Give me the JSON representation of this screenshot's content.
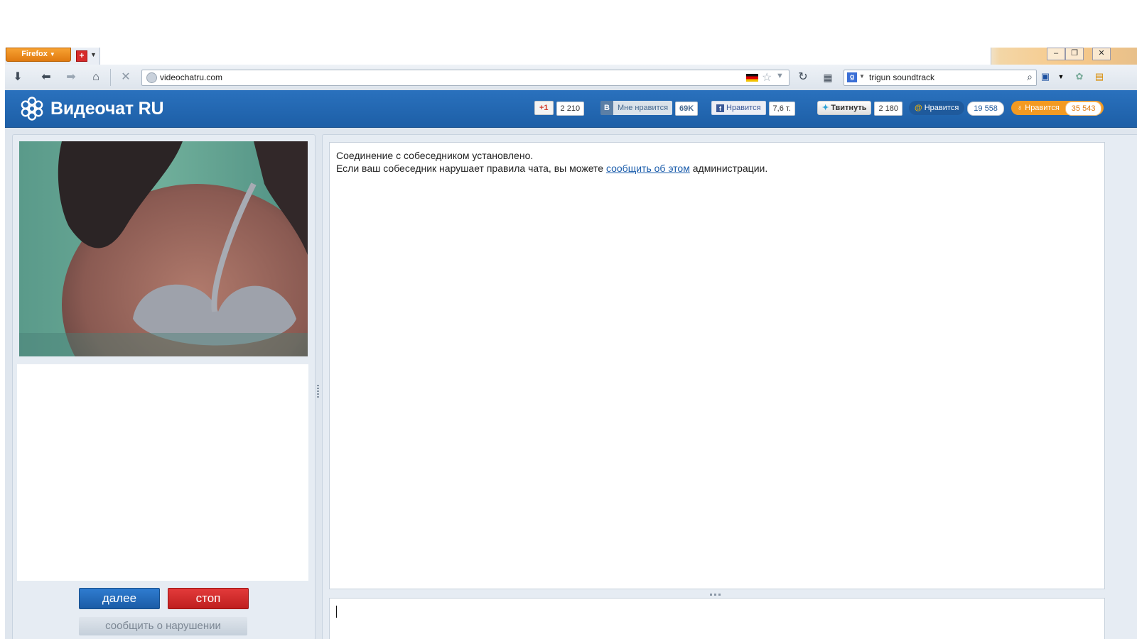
{
  "browser": {
    "menu_label": "Firefox",
    "url": "videochatru.com",
    "search_query": "trigun soundtrack"
  },
  "site": {
    "logo_text": "Видеочат RU",
    "social": {
      "gplus": {
        "label": "+1",
        "count": "2 210"
      },
      "vk": {
        "icon": "В",
        "label": "Мне нравится",
        "count": "69K"
      },
      "facebook": {
        "label": "Нравится",
        "count": "7,6 т."
      },
      "twitter": {
        "label": "Твитнуть",
        "count": "2 180"
      },
      "mailru": {
        "label": "Нравится",
        "count": "19 558"
      },
      "odnoklassniki": {
        "label": "Нравится",
        "count": "35 543"
      }
    }
  },
  "controls": {
    "next_label": "далее",
    "stop_label": "стоп",
    "report_label": "сообщить о нарушении"
  },
  "chat": {
    "line1": "Соединение с собеседником установлено.",
    "line2_prefix": "Если ваш собеседник нарушает правила чата, вы можете ",
    "line2_link": "сообщить об этом",
    "line2_suffix": " администрации."
  },
  "colors": {
    "header_blue": "#2a71bd",
    "next_blue": "#2f7cd0",
    "stop_red": "#e33b3b",
    "link_blue": "#1a5cab"
  }
}
